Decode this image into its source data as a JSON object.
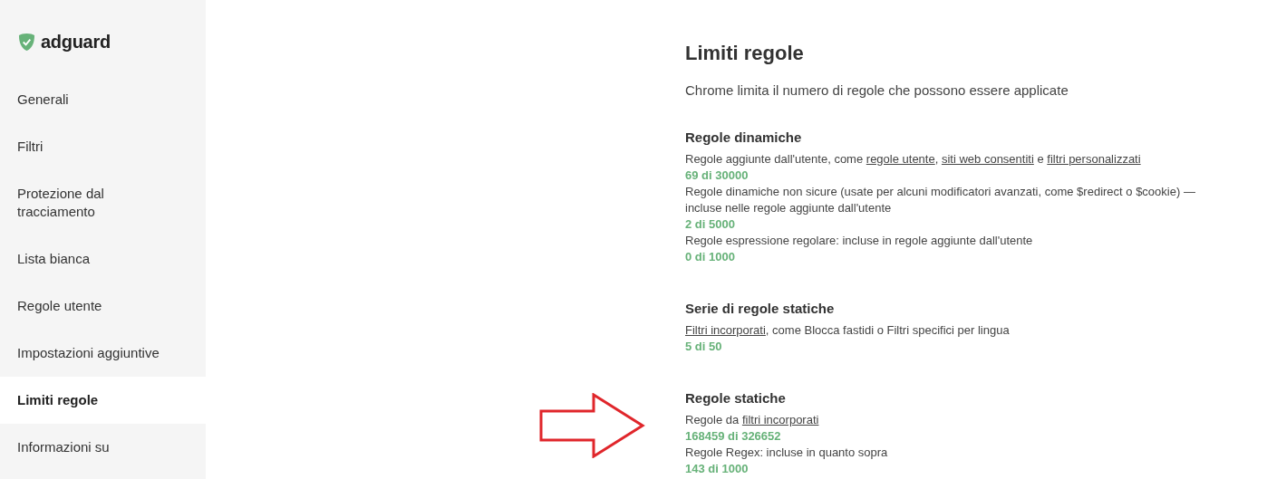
{
  "sidebar": {
    "logo": "adguard",
    "items": [
      {
        "label": "Generali",
        "selected": false
      },
      {
        "label": "Filtri",
        "selected": false
      },
      {
        "label": "Protezione dal tracciamento",
        "selected": false
      },
      {
        "label": "Lista bianca",
        "selected": false
      },
      {
        "label": "Regole utente",
        "selected": false
      },
      {
        "label": "Impostazioni aggiuntive",
        "selected": false
      },
      {
        "label": "Limiti regole",
        "selected": true
      },
      {
        "label": "Informazioni su",
        "selected": false
      }
    ]
  },
  "page": {
    "title": "Limiti regole",
    "subtitle": "Chrome limita il numero di regole che possono essere applicate",
    "sections": [
      {
        "heading": "Regole dinamiche",
        "entries": [
          {
            "description": [
              {
                "kind": "text",
                "text": "Regole aggiunte dall'utente, come "
              },
              {
                "kind": "link",
                "text": "regole utente"
              },
              {
                "kind": "text",
                "text": ", "
              },
              {
                "kind": "link",
                "text": "siti web consentiti"
              },
              {
                "kind": "text",
                "text": " e "
              },
              {
                "kind": "link",
                "text": "filtri personalizzati"
              }
            ],
            "count": "69 di 30000"
          },
          {
            "description": [
              {
                "kind": "text",
                "text": "Regole dinamiche non sicure (usate per alcuni modificatori avanzati, come $redirect o $cookie) — incluse nelle regole aggiunte dall'utente"
              }
            ],
            "count": "2 di 5000"
          },
          {
            "description": [
              {
                "kind": "text",
                "text": "Regole espressione regolare: incluse in regole aggiunte dall'utente"
              }
            ],
            "count": "0 di 1000"
          }
        ]
      },
      {
        "heading": "Serie di regole statiche",
        "entries": [
          {
            "description": [
              {
                "kind": "link",
                "text": "Filtri incorporati"
              },
              {
                "kind": "text",
                "text": ", come Blocca fastidi o Filtri specifici per lingua"
              }
            ],
            "count": "5 di 50"
          }
        ]
      },
      {
        "heading": "Regole statiche",
        "entries": [
          {
            "description": [
              {
                "kind": "text",
                "text": "Regole da "
              },
              {
                "kind": "link",
                "text": "filtri incorporati"
              }
            ],
            "count": "168459 di 326652"
          },
          {
            "description": [
              {
                "kind": "text",
                "text": "Regole Regex: incluse in quanto sopra"
              }
            ],
            "count": "143 di 1000"
          }
        ]
      }
    ]
  }
}
